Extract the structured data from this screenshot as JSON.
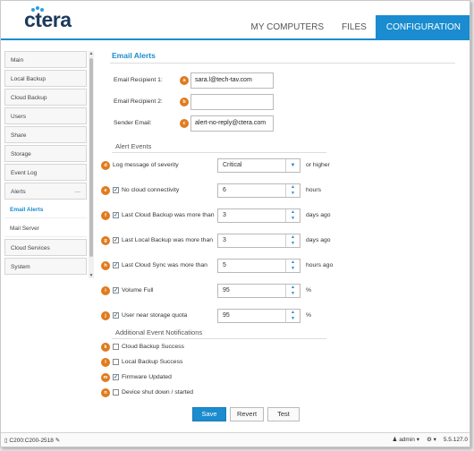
{
  "brand": {
    "logo_text": "ctera",
    "accent": "#1a8ccf",
    "badge_color": "#e07b1d"
  },
  "nav": {
    "items": [
      "MY COMPUTERS",
      "FILES",
      "CONFIGURATION"
    ],
    "active": "CONFIGURATION"
  },
  "sidebar": {
    "items": [
      {
        "label": "Main"
      },
      {
        "label": "Local Backup"
      },
      {
        "label": "Cloud Backup"
      },
      {
        "label": "Users"
      },
      {
        "label": "Share"
      },
      {
        "label": "Storage"
      },
      {
        "label": "Event Log"
      },
      {
        "label": "Alerts",
        "expander": "—"
      },
      {
        "label": "Email Alerts"
      },
      {
        "label": "Mail Server"
      },
      {
        "label": "Cloud Services"
      },
      {
        "label": "System"
      }
    ]
  },
  "page": {
    "title": "Email Alerts",
    "recipient1": {
      "badge": "a",
      "label": "Email Recipient 1:",
      "value": "sara.l@tech-tav.com"
    },
    "recipient2": {
      "badge": "b",
      "label": "Email Recipient 2:",
      "value": ""
    },
    "sender": {
      "badge": "c",
      "label": "Sender Email:",
      "value": "alert-no-reply@ctera.com"
    },
    "alert_events_title": "Alert Events",
    "severity": {
      "badge": "d",
      "label": "Log message of severity",
      "value": "Critical",
      "suffix": "or higher"
    },
    "events": [
      {
        "badge": "e",
        "checked": true,
        "label": "No cloud connectivity",
        "value": "6",
        "unit": "hours"
      },
      {
        "badge": "f",
        "checked": true,
        "label": "Last Cloud Backup was more than",
        "value": "3",
        "unit": "days ago"
      },
      {
        "badge": "g",
        "checked": true,
        "label": "Last Local Backup was more than",
        "value": "3",
        "unit": "days ago"
      },
      {
        "badge": "h",
        "checked": true,
        "label": "Last Cloud Sync was more than",
        "value": "5",
        "unit": "hours ago"
      },
      {
        "badge": "i",
        "checked": true,
        "label": "Volume Full",
        "value": "95",
        "unit": "%"
      },
      {
        "badge": "j",
        "checked": true,
        "label": "User near storage quota",
        "value": "95",
        "unit": "%"
      }
    ],
    "additional_title": "Additional Event Notifications",
    "notifications": [
      {
        "badge": "k",
        "checked": false,
        "label": "Cloud Backup Success"
      },
      {
        "badge": "l",
        "checked": false,
        "label": "Local Backup Success"
      },
      {
        "badge": "m",
        "checked": true,
        "label": "Firmware Updated"
      },
      {
        "badge": "n",
        "checked": false,
        "label": "Device shut down / started"
      }
    ],
    "buttons": {
      "save": "Save",
      "revert": "Revert",
      "test": "Test"
    }
  },
  "footer": {
    "device": "C200:C200-2518",
    "user": "admin",
    "version": "5.5.127.0"
  }
}
